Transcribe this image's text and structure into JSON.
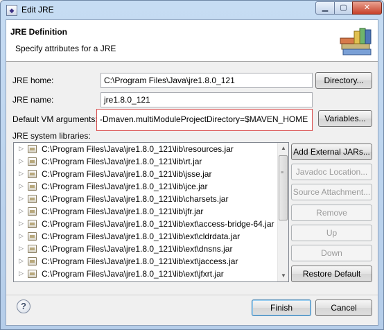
{
  "window": {
    "title": "Edit JRE",
    "app_icon": "eclipse-dialog-icon"
  },
  "header": {
    "title": "JRE Definition",
    "subtitle": "Specify attributes for a JRE",
    "icon": "library-books-icon"
  },
  "form": {
    "jre_home_label": "JRE home:",
    "jre_home_value": "C:\\Program Files\\Java\\jre1.8.0_121",
    "jre_name_label": "JRE name:",
    "jre_name_value": "jre1.8.0_121",
    "vm_args_label": "Default VM arguments:",
    "vm_args_value": "-Dmaven.multiModuleProjectDirectory=$MAVEN_HOME",
    "libraries_label": "JRE system libraries:"
  },
  "buttons": {
    "directory": "Directory...",
    "variables": "Variables...",
    "add_external_jars": "Add External JARs...",
    "javadoc_location": "Javadoc Location...",
    "source_attachment": "Source Attachment...",
    "remove": "Remove",
    "up": "Up",
    "down": "Down",
    "restore_default": "Restore Default",
    "finish": "Finish",
    "cancel": "Cancel"
  },
  "libraries": [
    "C:\\Program Files\\Java\\jre1.8.0_121\\lib\\resources.jar",
    "C:\\Program Files\\Java\\jre1.8.0_121\\lib\\rt.jar",
    "C:\\Program Files\\Java\\jre1.8.0_121\\lib\\jsse.jar",
    "C:\\Program Files\\Java\\jre1.8.0_121\\lib\\jce.jar",
    "C:\\Program Files\\Java\\jre1.8.0_121\\lib\\charsets.jar",
    "C:\\Program Files\\Java\\jre1.8.0_121\\lib\\jfr.jar",
    "C:\\Program Files\\Java\\jre1.8.0_121\\lib\\ext\\access-bridge-64.jar",
    "C:\\Program Files\\Java\\jre1.8.0_121\\lib\\ext\\cldrdata.jar",
    "C:\\Program Files\\Java\\jre1.8.0_121\\lib\\ext\\dnsns.jar",
    "C:\\Program Files\\Java\\jre1.8.0_121\\lib\\ext\\jaccess.jar",
    "C:\\Program Files\\Java\\jre1.8.0_121\\lib\\ext\\jfxrt.jar"
  ],
  "colors": {
    "highlight_border": "#d74a4a",
    "close_button": "#c7412a"
  }
}
